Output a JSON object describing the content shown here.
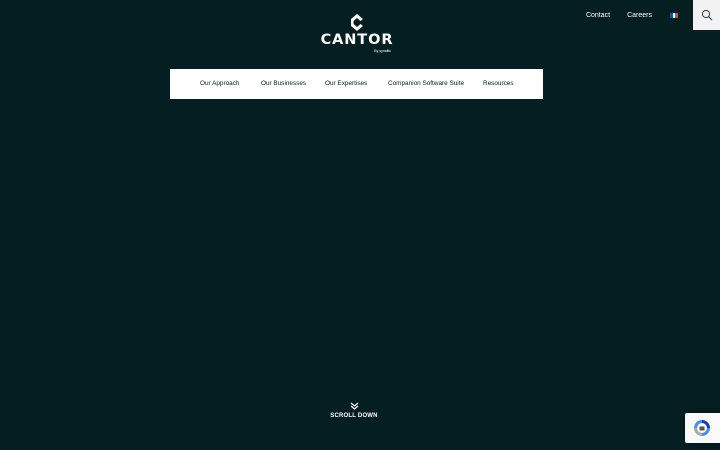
{
  "header": {
    "links": [
      {
        "label": "Contact"
      },
      {
        "label": "Careers"
      }
    ],
    "language_flag": "fr-flag-icon",
    "search_icon": "search-icon"
  },
  "logo": {
    "wordmark": "CANTOR",
    "tagline": "By synaltic"
  },
  "nav": {
    "items": [
      {
        "label": "Our Approach"
      },
      {
        "label": "Our Businesses"
      },
      {
        "label": "Our Expertises"
      },
      {
        "label": "Companion Software Suite"
      },
      {
        "label": "Resources"
      }
    ]
  },
  "scroll": {
    "label": "SCROLL DOWN",
    "icon": "double-chevron-down-icon"
  },
  "recaptcha": {
    "icon": "recaptcha-icon"
  },
  "colors": {
    "background": "#041e22",
    "nav_background": "#ffffff",
    "search_background": "#f2f2f2",
    "flag_blue": "#0055a4",
    "flag_white": "#ffffff",
    "flag_red": "#ef4135"
  }
}
